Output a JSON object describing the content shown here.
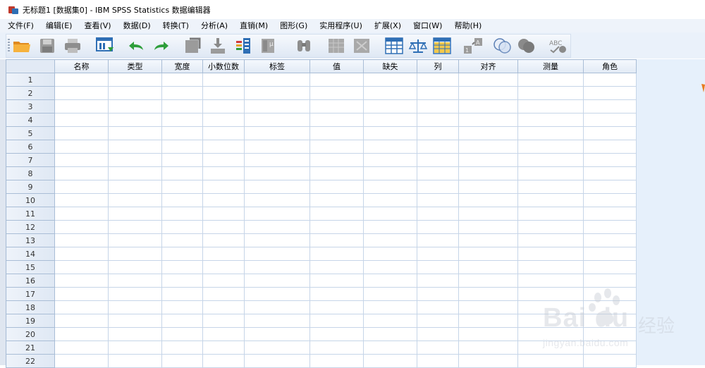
{
  "window": {
    "title": "无标题1 [数据集0] - IBM SPSS Statistics 数据编辑器"
  },
  "menu": [
    {
      "id": "file",
      "label": "文件(F)"
    },
    {
      "id": "edit",
      "label": "编辑(E)"
    },
    {
      "id": "view",
      "label": "查看(V)"
    },
    {
      "id": "data",
      "label": "数据(D)"
    },
    {
      "id": "transform",
      "label": "转换(T)"
    },
    {
      "id": "analyze",
      "label": "分析(A)"
    },
    {
      "id": "directmarketing",
      "label": "直销(M)"
    },
    {
      "id": "graphs",
      "label": "图形(G)"
    },
    {
      "id": "utilities",
      "label": "实用程序(U)"
    },
    {
      "id": "extensions",
      "label": "扩展(X)"
    },
    {
      "id": "window",
      "label": "窗口(W)"
    },
    {
      "id": "help",
      "label": "帮助(H)"
    }
  ],
  "toolbar": [
    {
      "name": "open-folder-icon",
      "enabled": true
    },
    {
      "name": "save-icon",
      "enabled": false
    },
    {
      "name": "print-icon",
      "enabled": false
    },
    {
      "name": "recall-dialog-icon",
      "enabled": true
    },
    {
      "name": "undo-icon",
      "enabled": true
    },
    {
      "name": "redo-icon",
      "enabled": true
    },
    {
      "name": "goto-case-icon",
      "enabled": false
    },
    {
      "name": "goto-variable-icon",
      "enabled": false
    },
    {
      "name": "variables-icon",
      "enabled": true
    },
    {
      "name": "run-descriptives-icon",
      "enabled": false
    },
    {
      "name": "find-icon",
      "enabled": false
    },
    {
      "name": "insert-cases-icon",
      "enabled": false
    },
    {
      "name": "insert-variable-icon",
      "enabled": false
    },
    {
      "name": "split-file-icon",
      "enabled": true
    },
    {
      "name": "weight-cases-icon",
      "enabled": true
    },
    {
      "name": "select-cases-icon",
      "enabled": true
    },
    {
      "name": "value-labels-icon",
      "enabled": false
    },
    {
      "name": "use-variable-sets-icon",
      "enabled": true
    },
    {
      "name": "show-all-variables-icon",
      "enabled": false
    },
    {
      "name": "spell-check-icon",
      "enabled": false
    }
  ],
  "spellcheck_label": "ABC",
  "grid": {
    "columns": [
      "名称",
      "类型",
      "宽度",
      "小数位数",
      "标签",
      "值",
      "缺失",
      "列",
      "对齐",
      "测量",
      "角色"
    ],
    "rows": [
      "1",
      "2",
      "3",
      "4",
      "5",
      "6",
      "7",
      "8",
      "9",
      "10",
      "11",
      "12",
      "13",
      "14",
      "15",
      "16",
      "17",
      "18",
      "19",
      "20",
      "21",
      "22"
    ]
  },
  "watermark": {
    "main": "Bai du",
    "cn": "经验",
    "url": "jingyan.baidu.com"
  }
}
